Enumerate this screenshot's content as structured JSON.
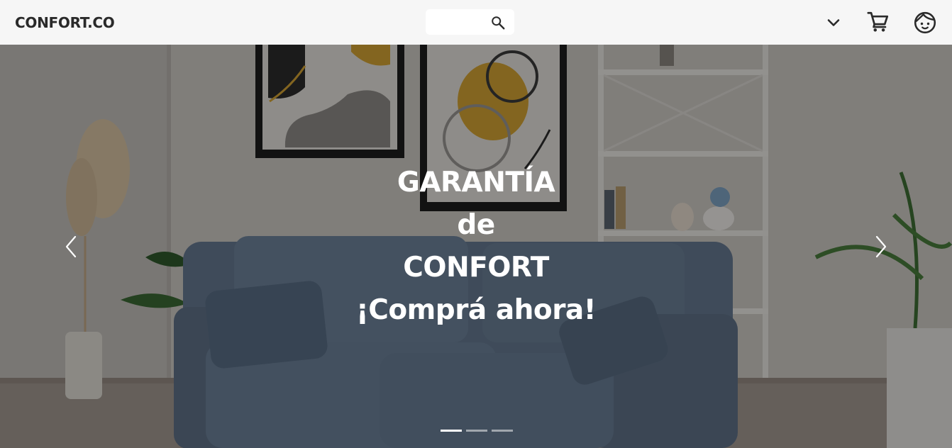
{
  "header": {
    "logo": "CONFORT.CO",
    "search": {
      "value": "",
      "placeholder": ""
    },
    "icons": [
      "search-icon",
      "chevron-down-icon",
      "cart-icon",
      "user-icon"
    ]
  },
  "hero": {
    "lines": [
      "GARANTÍA",
      "de",
      "CONFORT",
      "¡Comprá ahora!"
    ],
    "overlay_color": "#000000",
    "slides_total": 3,
    "active_slide": 1
  },
  "colors": {
    "topbar_bg": "#f6f6f6",
    "logo_text": "#2a2a2a",
    "hero_text": "#ffffff",
    "sofa": "#6d7f95",
    "frame_accent": "#d4a435"
  }
}
